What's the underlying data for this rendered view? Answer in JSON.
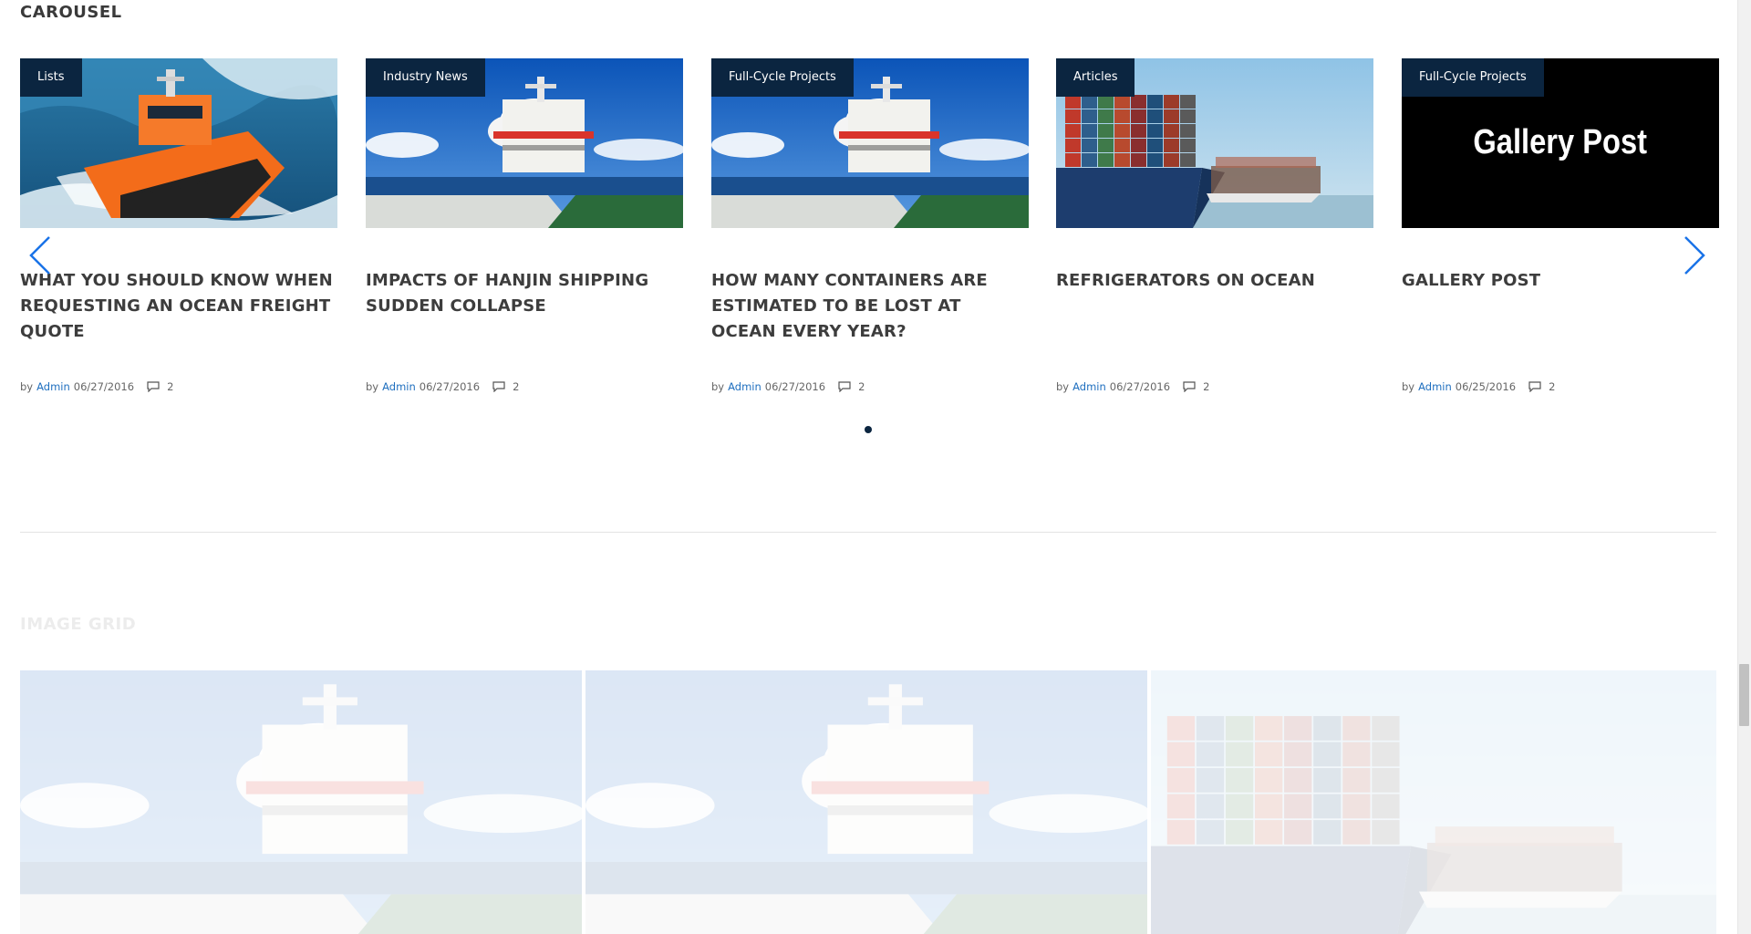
{
  "carousel": {
    "title": "CAROUSEL",
    "cards": [
      {
        "category": "Lists",
        "title": "WHAT YOU SHOULD KNOW WHEN REQUESTING AN OCEAN FREIGHT QUOTE",
        "by": "by",
        "author": "Admin",
        "date": "06/27/2016",
        "comments": "2",
        "image": "orange-pilot-boat"
      },
      {
        "category": "Industry News",
        "title": "IMPACTS OF HANJIN SHIPPING SUDDEN COLLAPSE",
        "by": "by",
        "author": "Admin",
        "date": "06/27/2016",
        "comments": "2",
        "image": "tanker-deck"
      },
      {
        "category": "Full-Cycle Projects",
        "title": "HOW MANY CONTAINERS ARE ESTIMATED TO BE LOST AT OCEAN EVERY YEAR?",
        "by": "by",
        "author": "Admin",
        "date": "06/27/2016",
        "comments": "2",
        "image": "tanker-deck"
      },
      {
        "category": "Articles",
        "title": "REFRIGERATORS ON OCEAN",
        "by": "by",
        "author": "Admin",
        "date": "06/27/2016",
        "comments": "2",
        "image": "container-ship"
      },
      {
        "category": "Full-Cycle Projects",
        "title": "GALLERY POST",
        "by": "by",
        "author": "Admin",
        "date": "06/25/2016",
        "comments": "2",
        "image": "gallery-post",
        "image_text": "Gallery Post"
      }
    ],
    "prev_icon": "chevron-left-icon",
    "next_icon": "chevron-right-icon",
    "pager": {
      "pages": 1,
      "active": 1
    }
  },
  "image_grid": {
    "title": "IMAGE GRID",
    "items": [
      "tanker-deck",
      "tanker-deck",
      "container-ship"
    ]
  },
  "colors": {
    "badge_bg": "#0b2540",
    "link": "#1f6fbf",
    "arrow": "#1a73e8"
  }
}
